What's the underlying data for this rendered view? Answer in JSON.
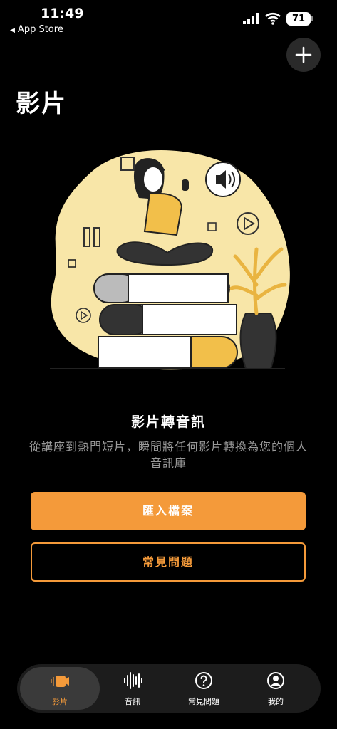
{
  "status_bar": {
    "time": "11:49",
    "back_label": "App Store",
    "battery": "71"
  },
  "header": {
    "title": "影片"
  },
  "empty_state": {
    "heading": "影片轉音訊",
    "description": "從講座到熱門短片，瞬間將任何影片轉換為您的個人音訊庫"
  },
  "actions": {
    "import_label": "匯入檔案",
    "faq_label": "常見問題"
  },
  "tabs": [
    {
      "label": "影片",
      "icon": "video-camera-icon",
      "active": true
    },
    {
      "label": "音訊",
      "icon": "waveform-icon",
      "active": false
    },
    {
      "label": "常見問題",
      "icon": "question-circle-icon",
      "active": false
    },
    {
      "label": "我的",
      "icon": "profile-icon",
      "active": false
    }
  ],
  "colors": {
    "accent": "#F49A3A",
    "illustration_yellow": "#F8E6A8",
    "background": "#000000"
  }
}
